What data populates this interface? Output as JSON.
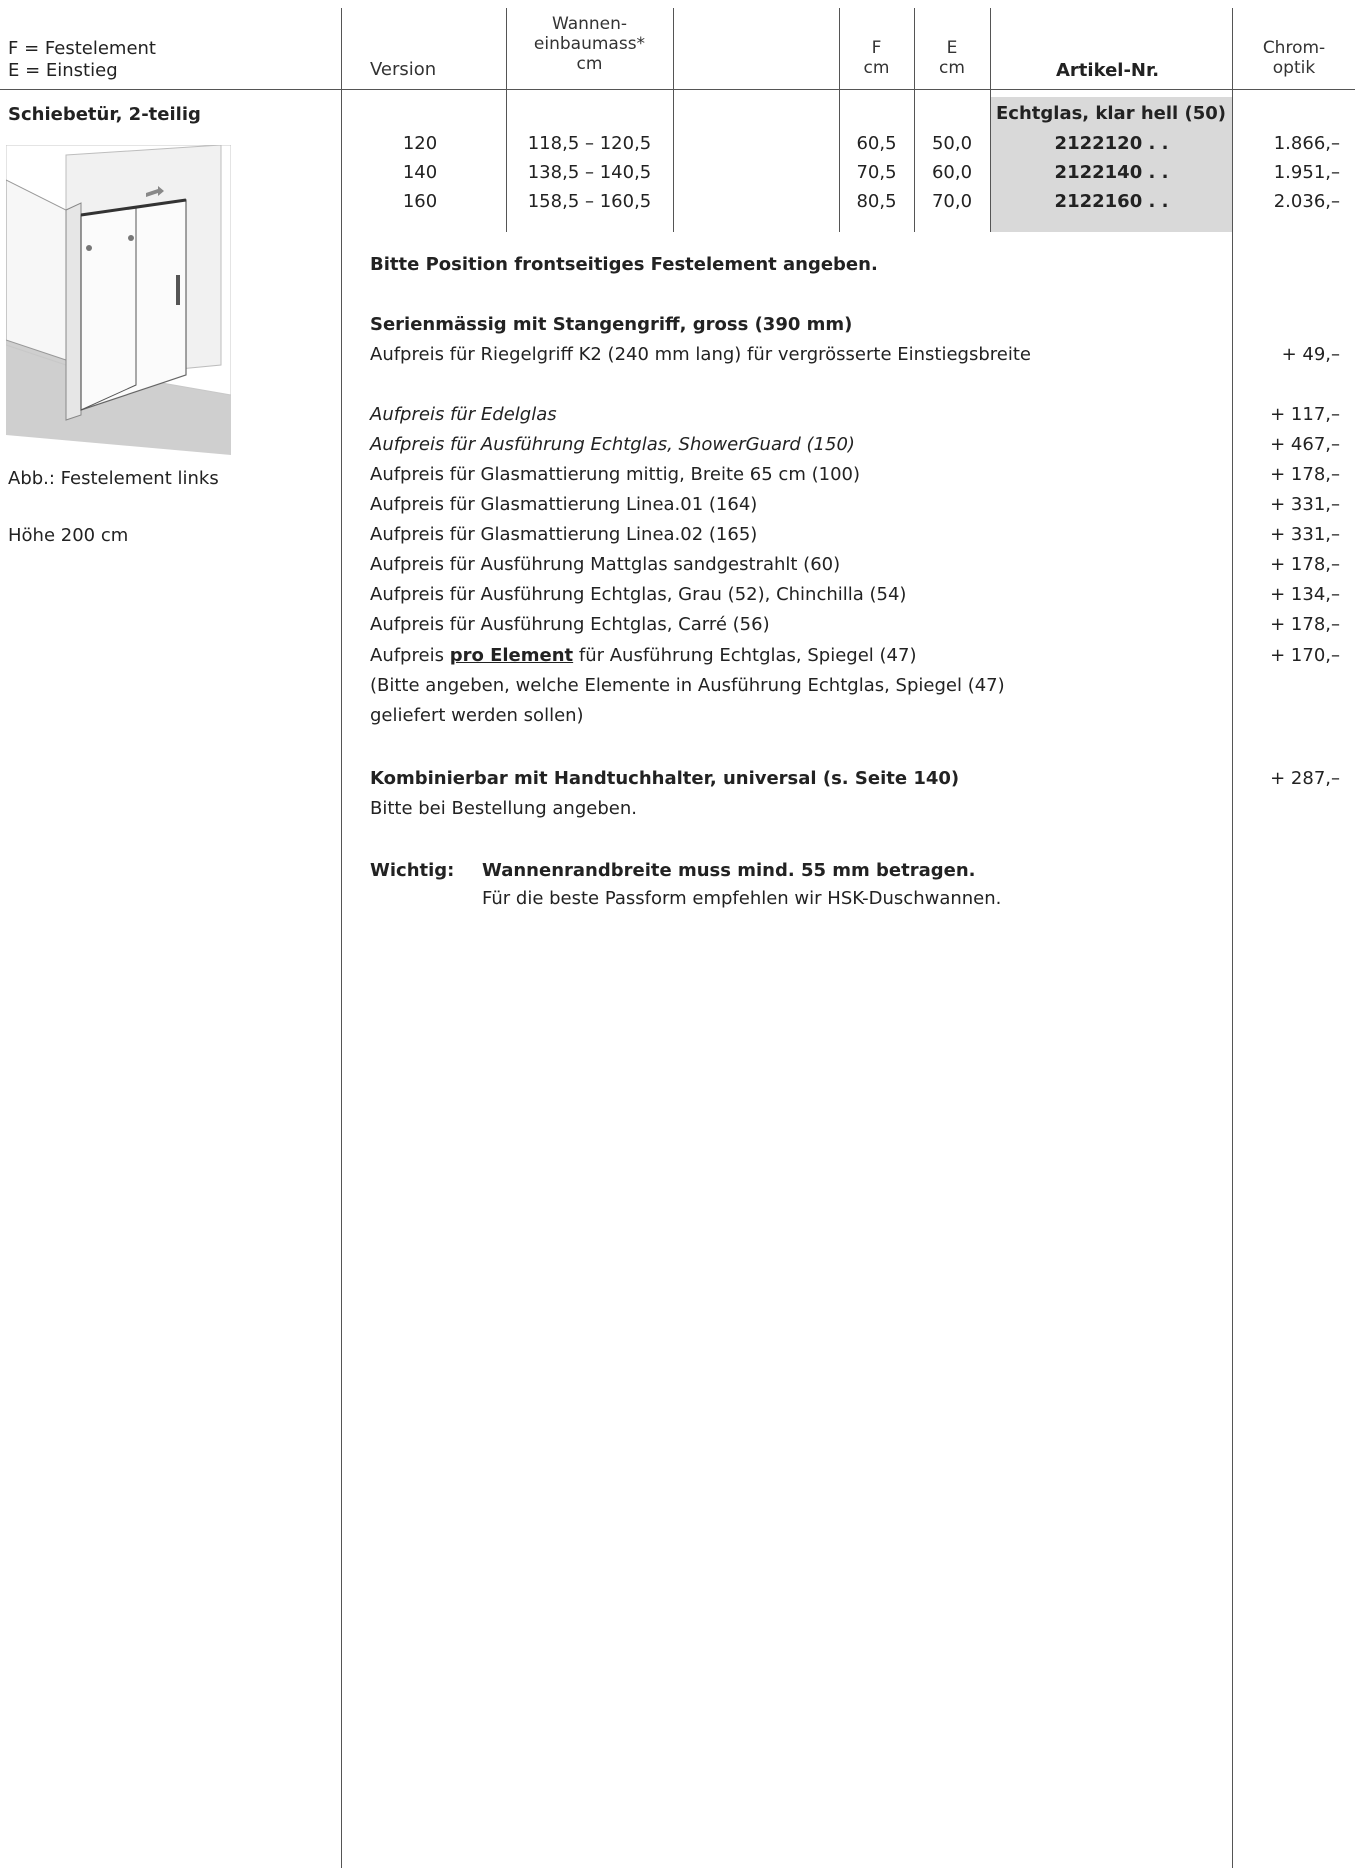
{
  "legend": [
    "F = Festelement",
    "E = Einstieg"
  ],
  "header": {
    "version": "Version",
    "wannen": [
      "Wannen-",
      "einbaumass*",
      "cm"
    ],
    "f": [
      "F",
      "cm"
    ],
    "e": [
      "E",
      "cm"
    ],
    "artikel": "Artikel-Nr.",
    "chrom": [
      "Chrom-",
      "optik"
    ]
  },
  "product_title": "Schiebetür, 2-teilig",
  "image_caption": "Abb.: Festelement links",
  "height": "Höhe 200 cm",
  "glass_header": "Echtglas, klar hell (50)",
  "rows": [
    {
      "version": "120",
      "wannen": "118,5 – 120,5",
      "f": "60,5",
      "e": "50,0",
      "artikel": "2122120 . .",
      "price": "1.866,–"
    },
    {
      "version": "140",
      "wannen": "138,5 – 140,5",
      "f": "70,5",
      "e": "60,0",
      "artikel": "2122140 . .",
      "price": "1.951,–"
    },
    {
      "version": "160",
      "wannen": "158,5 – 160,5",
      "f": "80,5",
      "e": "70,0",
      "artikel": "2122160 . .",
      "price": "2.036,–"
    }
  ],
  "position_note": "Bitte Position frontseitiges Festelement angeben.",
  "serien_title": "Serienmässig mit Stangengriff, gross (390 mm)",
  "serien_line": "Aufpreis für Riegelgriff K2 (240 mm lang) für vergrösserte Einstiegsbreite",
  "serien_price": "+ 49,–",
  "options": [
    {
      "text": "Aufpreis für Edelglas",
      "price": "+ 117,–"
    },
    {
      "text": "Aufpreis für Ausführung Echtglas, ShowerGuard (150)",
      "price": "+ 467,–"
    },
    {
      "text": "Aufpreis für Glasmattierung mittig, Breite 65 cm (100)",
      "price": "+ 178,–"
    },
    {
      "text": "Aufpreis für Glasmattierung Linea.01 (164)",
      "price": "+ 331,–"
    },
    {
      "text": "Aufpreis für Glasmattierung Linea.02 (165)",
      "price": "+ 331,–"
    },
    {
      "text": "Aufpreis für Ausführung Mattglas sandgestrahlt (60)",
      "price": "+ 178,–"
    },
    {
      "text": "Aufpreis für Ausführung Echtglas, Grau (52), Chinchilla (54)",
      "price": "+ 134,–"
    },
    {
      "text": "Aufpreis für Ausführung Echtglas, Carré (56)",
      "price": "+ 178,–"
    }
  ],
  "spiegel": {
    "pre": "Aufpreis",
    "emph": "pro Element",
    "post": "für Ausführung Echtglas, Spiegel (47)",
    "price": "+ 170,–"
  },
  "spiegel_note": [
    "(Bitte angeben, welche Elemente in Ausführung Echtglas, Spiegel (47)",
    "geliefert werden sollen)"
  ],
  "kombi_title": "Kombinierbar mit Handtuchhalter, universal (s. Seite 140)",
  "kombi_price": "+ 287,–",
  "kombi_note": "Bitte bei Bestellung angeben.",
  "wichtig_label": "Wichtig:",
  "wichtig_text": "Wannenrandbreite muss mind. 55 mm betragen.",
  "wichtig_note": "Für die beste Passform empfehlen wir HSK-Duschwannen."
}
